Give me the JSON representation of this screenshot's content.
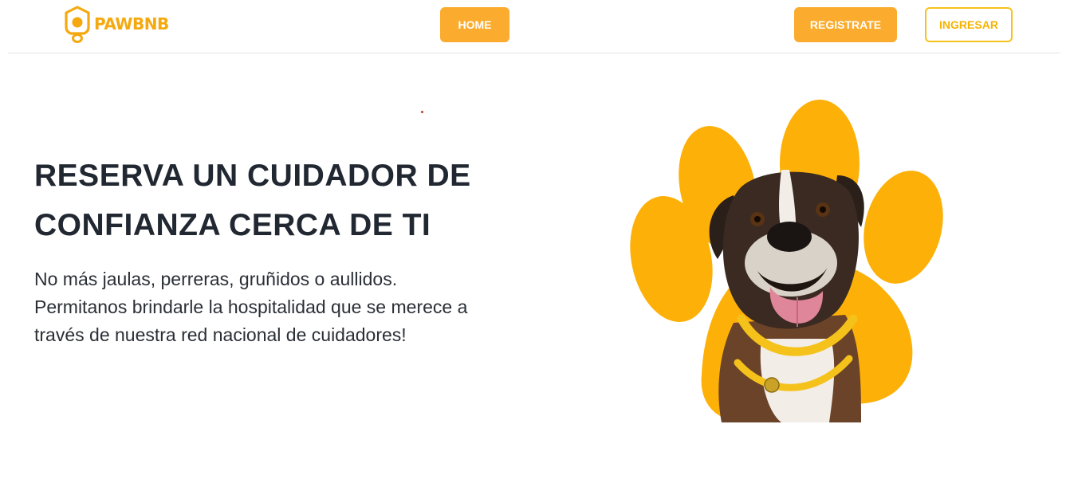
{
  "brand": {
    "name": "PAWBNB",
    "color": "#f5a90f"
  },
  "nav": {
    "home_label": "HOME",
    "register_label": "REGISTRATE",
    "login_label": "INGRESAR"
  },
  "hero": {
    "title_line1": "RESERVA UN CUIDADOR DE",
    "title_line2": "CONFIANZA CERCA DE TI",
    "description": "No más jaulas, perreras, gruñidos o aullidos. Permitanos brindarle la hospitalidad que se merece a través de nuestra red nacional de cuidadores!",
    "image": "paw-shaped-frame-with-boxer-dog"
  },
  "colors": {
    "accent": "#fbac2e",
    "paw": "#fdb007",
    "text": "#222831"
  }
}
